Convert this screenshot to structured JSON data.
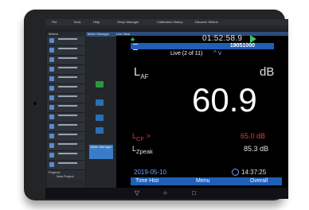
{
  "menu": {
    "items": [
      "File",
      "Tools",
      "Help",
      "Setup Manager",
      "Calibration History",
      "Discover Meters"
    ]
  },
  "left_panel": {
    "header": "Meters",
    "rows": 13,
    "projects_label": "Projects",
    "new_project": "New Project"
  },
  "middle_panel": {
    "header": "Meter Manager",
    "button_label": "Meter Manager"
  },
  "device": {
    "header": "Live View",
    "clock": "01:52:58.9",
    "serial": "19051000",
    "live_label": "Live (2 of 11)",
    "nav_arrows": "^ v",
    "main_metric": {
      "label_main": "L",
      "label_sub": "AF",
      "unit": "dB",
      "value": "60.9"
    },
    "lcf": {
      "label_main": "L",
      "label_sub": "CF",
      "label_suffix": " >",
      "value": "65.0 dB",
      "color": "#d94040"
    },
    "lzpeak": {
      "label_main": "L",
      "label_sub": "Zpeak",
      "value": "85.3 dB"
    },
    "date": "2019-05-10",
    "time": "14:37:25",
    "bottom": {
      "left": "Time Hist",
      "center": "Menu",
      "right": "Overall"
    }
  },
  "android_nav": {
    "back": "▽",
    "home": "○",
    "recents": "□"
  },
  "colors": {
    "accent": "#1f5fb8",
    "go": "#34c759"
  }
}
